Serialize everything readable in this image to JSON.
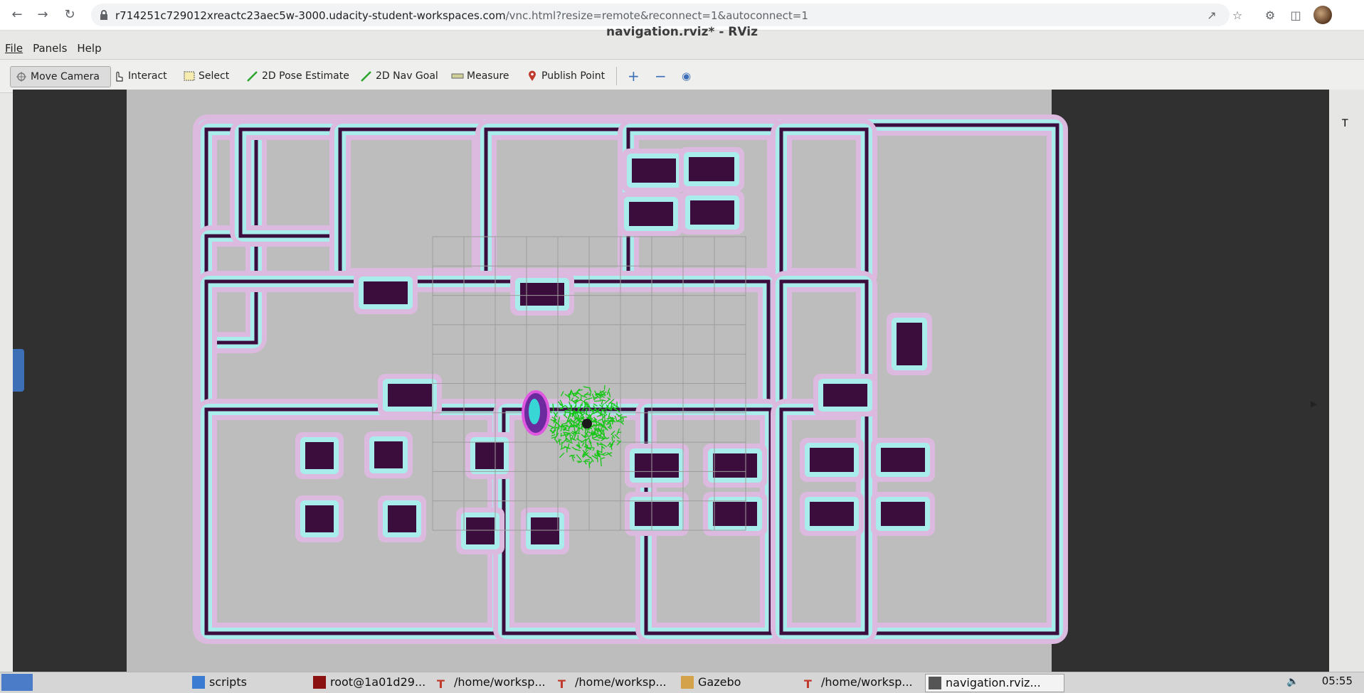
{
  "browser": {
    "url_host": "r714251c729012xreactc23aec5w-3000.udacity-student-workspaces.com",
    "url_path": "/vnc.html?resize=remote&reconnect=1&autoconnect=1"
  },
  "window": {
    "title": "navigation.rviz* - RViz"
  },
  "menu": {
    "file": "File",
    "panels": "Panels",
    "help": "Help"
  },
  "toolbar": {
    "move_camera": "Move Camera",
    "interact": "Interact",
    "select": "Select",
    "pose_estimate": "2D Pose Estimate",
    "nav_goal": "2D Nav Goal",
    "measure": "Measure",
    "publish_point": "Publish Point"
  },
  "right_panel": {
    "label": "T"
  },
  "taskbar": {
    "items": [
      "scripts",
      "root@1a01d29...",
      "/home/worksp...",
      "/home/worksp...",
      "Gazebo",
      "/home/worksp...",
      "navigation.rviz..."
    ],
    "clock": "05:55"
  },
  "colors": {
    "wall": "#3b0d3d",
    "inflation_cyan": "#a9ecec",
    "inflation_pink": "#dcb9de",
    "free_space": "#bdbdbd",
    "particles": "#15c615"
  }
}
